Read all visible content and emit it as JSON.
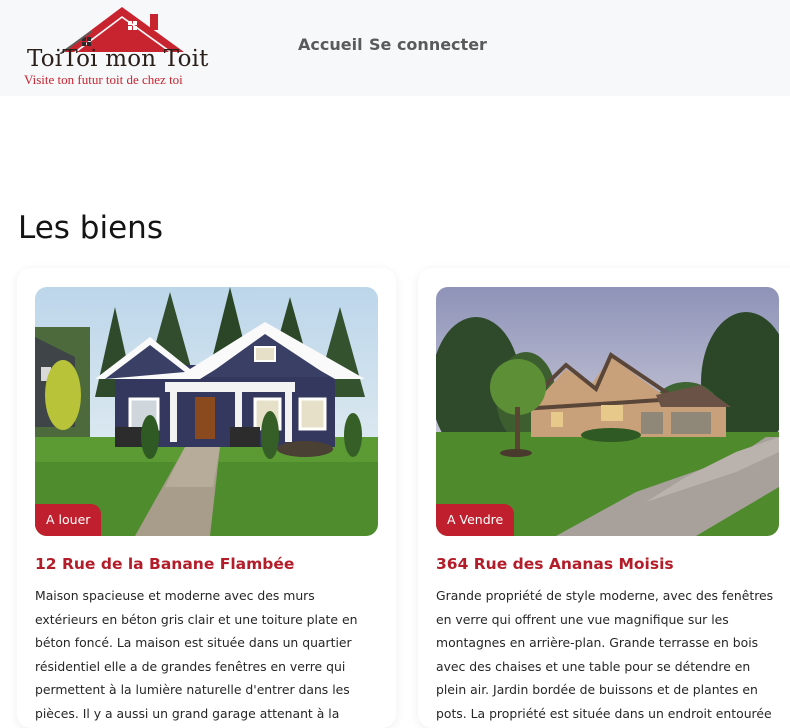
{
  "brand": {
    "name": "ToiToi mon Toit",
    "tagline": "Visite ton futur toit de chez toi",
    "colors": {
      "accent": "#c0202e",
      "title_red": "#b31d2a",
      "header_bg": "#f7f8fa"
    }
  },
  "nav": {
    "home_label": "Accueil",
    "login_label": "Se connecter"
  },
  "section": {
    "title": "Les biens"
  },
  "properties": [
    {
      "badge": "A louer",
      "title": "12 Rue de la Banane Flambée",
      "description": "Maison spacieuse et moderne avec des murs extérieurs en béton gris clair et une toiture plate en béton foncé. La maison est située dans un quartier résidentiel elle a de grandes fenêtres en verre qui permettent à la lumière naturelle d'entrer dans les pièces. Il y a aussi un grand garage attenant à la maison situé dans un environnement"
    },
    {
      "badge": "A Vendre",
      "title": "364 Rue des Ananas Moisis",
      "description": "Grande propriété de style moderne, avec des fenêtres en verre qui offrent une vue magnifique sur les montagnes en arrière-plan. Grande terrasse en bois avec des chaises et une table pour se détendre en plein air. Jardin bordée de buissons et de plantes en pots. La propriété est située dans un endroit entourée de forêts et de montagnes"
    }
  ]
}
